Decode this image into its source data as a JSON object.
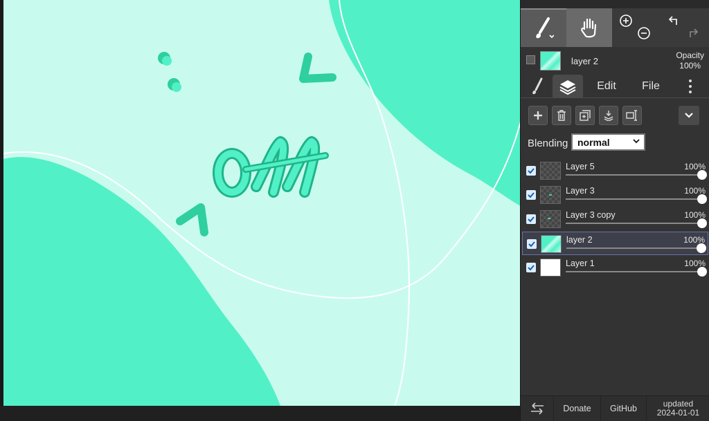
{
  "current_layer": {
    "name": "layer 2",
    "opacity_label": "Opacity",
    "opacity_value": "100%"
  },
  "tabs": [
    {
      "id": "brush",
      "icon": "brush-icon"
    },
    {
      "id": "layers",
      "icon": "layers-icon"
    },
    {
      "id": "edit",
      "label": "Edit"
    },
    {
      "id": "file",
      "label": "File"
    }
  ],
  "blending": {
    "label": "Blending",
    "value": "normal"
  },
  "layers": [
    {
      "name": "Layer 5",
      "opacity": "100%",
      "visible": true,
      "opacity_fraction": 1.0
    },
    {
      "name": "Layer 3",
      "opacity": "100%",
      "visible": true,
      "opacity_fraction": 1.0
    },
    {
      "name": "Layer 3 copy",
      "opacity": "100%",
      "visible": true,
      "opacity_fraction": 1.0
    },
    {
      "name": "layer 2",
      "opacity": "100%",
      "visible": true,
      "opacity_fraction": 1.0,
      "selected": true
    },
    {
      "name": "Layer 1",
      "opacity": "100%",
      "visible": true,
      "opacity_fraction": 1.0
    }
  ],
  "footer": {
    "donate": "Donate",
    "github": "GitHub",
    "updated_label": "updated",
    "updated_date": "2024-01-01"
  },
  "colors": {
    "canvas_light": "#c8fbee",
    "canvas_mint": "#52f0c6",
    "panel_bg": "#333333",
    "selection_border": "#6b72a8"
  }
}
